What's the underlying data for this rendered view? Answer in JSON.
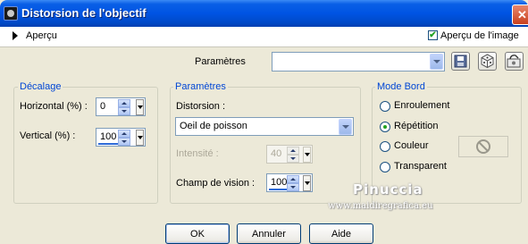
{
  "window": {
    "title": "Distorsion de l'objectif",
    "close_glyph": "✕"
  },
  "preview_bar": {
    "label": "Aperçu",
    "preview_checkbox_label": "Aperçu de l'image",
    "preview_checked": true
  },
  "presets": {
    "label": "Paramètres",
    "value": "",
    "icons": [
      "save-preset-icon",
      "reset-dice-icon",
      "preset-folder-icon"
    ]
  },
  "offset_group": {
    "title": "Décalage",
    "horizontal_label": "Horizontal (%) :",
    "horizontal_value": "0",
    "vertical_label": "Vertical (%) :",
    "vertical_value": "100"
  },
  "params_group": {
    "title": "Paramètres",
    "distortion_label": "Distorsion :",
    "distortion_value": "Oeil de poisson",
    "intensity_label": "Intensité :",
    "intensity_value": "40",
    "fov_label": "Champ de vision :",
    "fov_value": "100"
  },
  "edge_group": {
    "title": "Mode Bord",
    "options": [
      "Enroulement",
      "Répétition",
      "Couleur",
      "Transparent"
    ],
    "selected": "Répétition",
    "color_icon": "no-color-icon"
  },
  "buttons": {
    "ok": "OK",
    "cancel": "Annuler",
    "help": "Aide"
  },
  "watermark": {
    "line1": "Pinuccia",
    "line2": "www.maidiregrafica.eu"
  }
}
